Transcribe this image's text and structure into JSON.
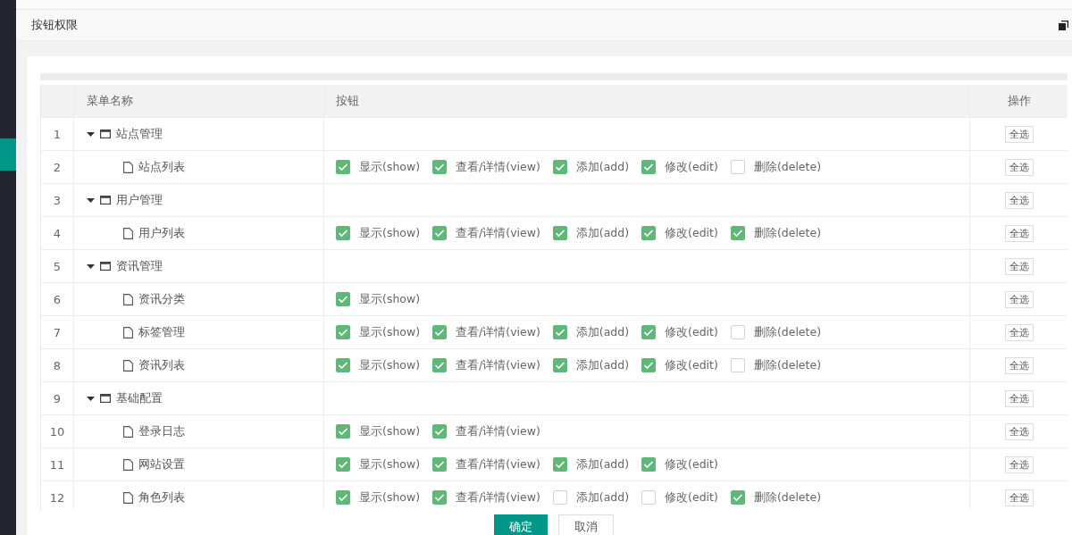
{
  "panel": {
    "title": "按钮权限"
  },
  "table": {
    "columns": [
      "菜单名称",
      "按钮",
      "操作"
    ],
    "rows": [
      {
        "index": "1",
        "kind": "group",
        "expanded": true,
        "name": "站点管理",
        "buttons": [],
        "action": "全选"
      },
      {
        "index": "2",
        "kind": "page",
        "name": "站点列表",
        "buttons": [
          {
            "label": "显示(show)",
            "checked": true
          },
          {
            "label": "查看/详情(view)",
            "checked": true
          },
          {
            "label": "添加(add)",
            "checked": true
          },
          {
            "label": "修改(edit)",
            "checked": true
          },
          {
            "label": "删除(delete)",
            "checked": false
          }
        ],
        "action": "全选"
      },
      {
        "index": "3",
        "kind": "group",
        "expanded": true,
        "name": "用户管理",
        "buttons": [],
        "action": "全选"
      },
      {
        "index": "4",
        "kind": "page",
        "name": "用户列表",
        "buttons": [
          {
            "label": "显示(show)",
            "checked": true
          },
          {
            "label": "查看/详情(view)",
            "checked": true
          },
          {
            "label": "添加(add)",
            "checked": true
          },
          {
            "label": "修改(edit)",
            "checked": true
          },
          {
            "label": "删除(delete)",
            "checked": true
          }
        ],
        "action": "全选"
      },
      {
        "index": "5",
        "kind": "group",
        "expanded": true,
        "name": "资讯管理",
        "buttons": [],
        "action": "全选"
      },
      {
        "index": "6",
        "kind": "page",
        "name": "资讯分类",
        "buttons": [
          {
            "label": "显示(show)",
            "checked": true
          }
        ],
        "action": "全选"
      },
      {
        "index": "7",
        "kind": "page",
        "name": "标签管理",
        "buttons": [
          {
            "label": "显示(show)",
            "checked": true
          },
          {
            "label": "查看/详情(view)",
            "checked": true
          },
          {
            "label": "添加(add)",
            "checked": true
          },
          {
            "label": "修改(edit)",
            "checked": true
          },
          {
            "label": "删除(delete)",
            "checked": false
          }
        ],
        "action": "全选"
      },
      {
        "index": "8",
        "kind": "page",
        "name": "资讯列表",
        "buttons": [
          {
            "label": "显示(show)",
            "checked": true
          },
          {
            "label": "查看/详情(view)",
            "checked": true
          },
          {
            "label": "添加(add)",
            "checked": true
          },
          {
            "label": "修改(edit)",
            "checked": true
          },
          {
            "label": "删除(delete)",
            "checked": false
          }
        ],
        "action": "全选"
      },
      {
        "index": "9",
        "kind": "group",
        "expanded": true,
        "name": "基础配置",
        "buttons": [],
        "action": "全选"
      },
      {
        "index": "10",
        "kind": "page",
        "name": "登录日志",
        "buttons": [
          {
            "label": "显示(show)",
            "checked": true
          },
          {
            "label": "查看/详情(view)",
            "checked": true
          }
        ],
        "action": "全选"
      },
      {
        "index": "11",
        "kind": "page",
        "name": "网站设置",
        "buttons": [
          {
            "label": "显示(show)",
            "checked": true
          },
          {
            "label": "查看/详情(view)",
            "checked": true
          },
          {
            "label": "添加(add)",
            "checked": true
          },
          {
            "label": "修改(edit)",
            "checked": true
          }
        ],
        "action": "全选"
      },
      {
        "index": "12",
        "kind": "page",
        "name": "角色列表",
        "buttons": [
          {
            "label": "显示(show)",
            "checked": true
          },
          {
            "label": "查看/详情(view)",
            "checked": true
          },
          {
            "label": "添加(add)",
            "checked": false
          },
          {
            "label": "修改(edit)",
            "checked": false
          },
          {
            "label": "删除(delete)",
            "checked": true
          }
        ],
        "action": "全选"
      }
    ]
  },
  "footer": {
    "buttons": [
      "确定",
      "取消"
    ]
  }
}
